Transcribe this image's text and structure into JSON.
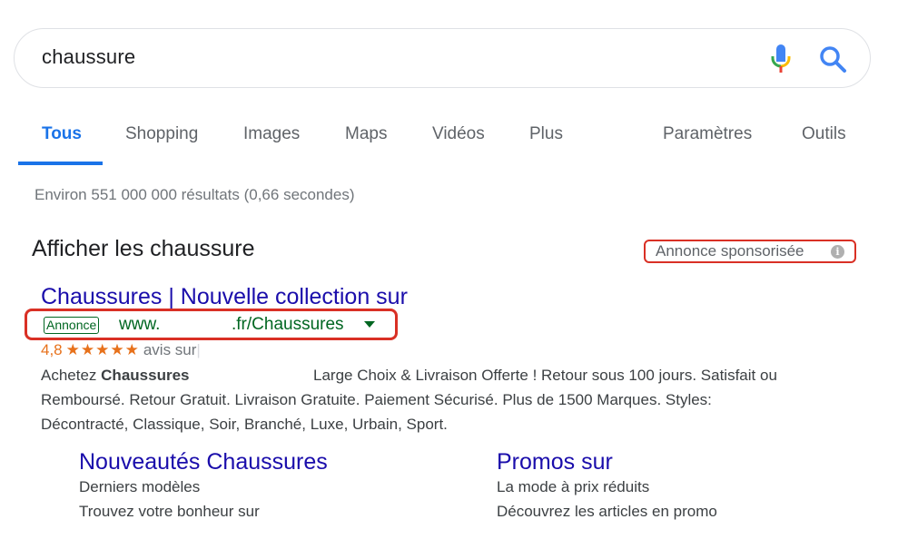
{
  "search": {
    "query": "chaussure"
  },
  "colors": {
    "accent": "#1a73e8",
    "link": "#1a0dab",
    "url_green": "#006621",
    "highlight_red": "#d93025",
    "rating_orange": "#e7711b"
  },
  "tabs": [
    {
      "label": "Tous",
      "active": true
    },
    {
      "label": "Shopping"
    },
    {
      "label": "Images"
    },
    {
      "label": "Maps"
    },
    {
      "label": "Vidéos"
    },
    {
      "label": "Plus"
    },
    {
      "label": "Paramètres"
    },
    {
      "label": "Outils"
    }
  ],
  "result_stats": "Environ 551 000 000 résultats (0,66 secondes)",
  "section": {
    "title": "Afficher les chaussure",
    "sponsored_label": "Annonce sponsorisée",
    "info_icon": "i"
  },
  "ad": {
    "title": "Chaussures | Nouvelle collection sur",
    "badge": "Annonce",
    "url_prefix": "www.",
    "url_suffix": ".fr/Chaussures",
    "rating_value": "4,8",
    "rating_stars": "★★★★★",
    "rating_text": "avis sur",
    "desc_line1_start": "Achetez ",
    "desc_line1_bold": "Chaussures",
    "desc_line1_end": "Large Choix & Livraison Offerte ! Retour sous 100 jours. Satisfait ou",
    "desc_line2": "Remboursé. Retour Gratuit. Livraison Gratuite. Paiement Sécurisé. Plus de 1500 Marques. Styles:",
    "desc_line3": "Décontracté, Classique, Soir, Branché, Luxe, Urbain, Sport."
  },
  "sitelinks": [
    {
      "title": "Nouveautés Chaussures",
      "line1": "Derniers modèles",
      "line2": "Trouvez votre bonheur sur"
    },
    {
      "title": "Promos sur",
      "line1": "La mode à prix réduits",
      "line2": "Découvrez les articles en promo"
    }
  ]
}
